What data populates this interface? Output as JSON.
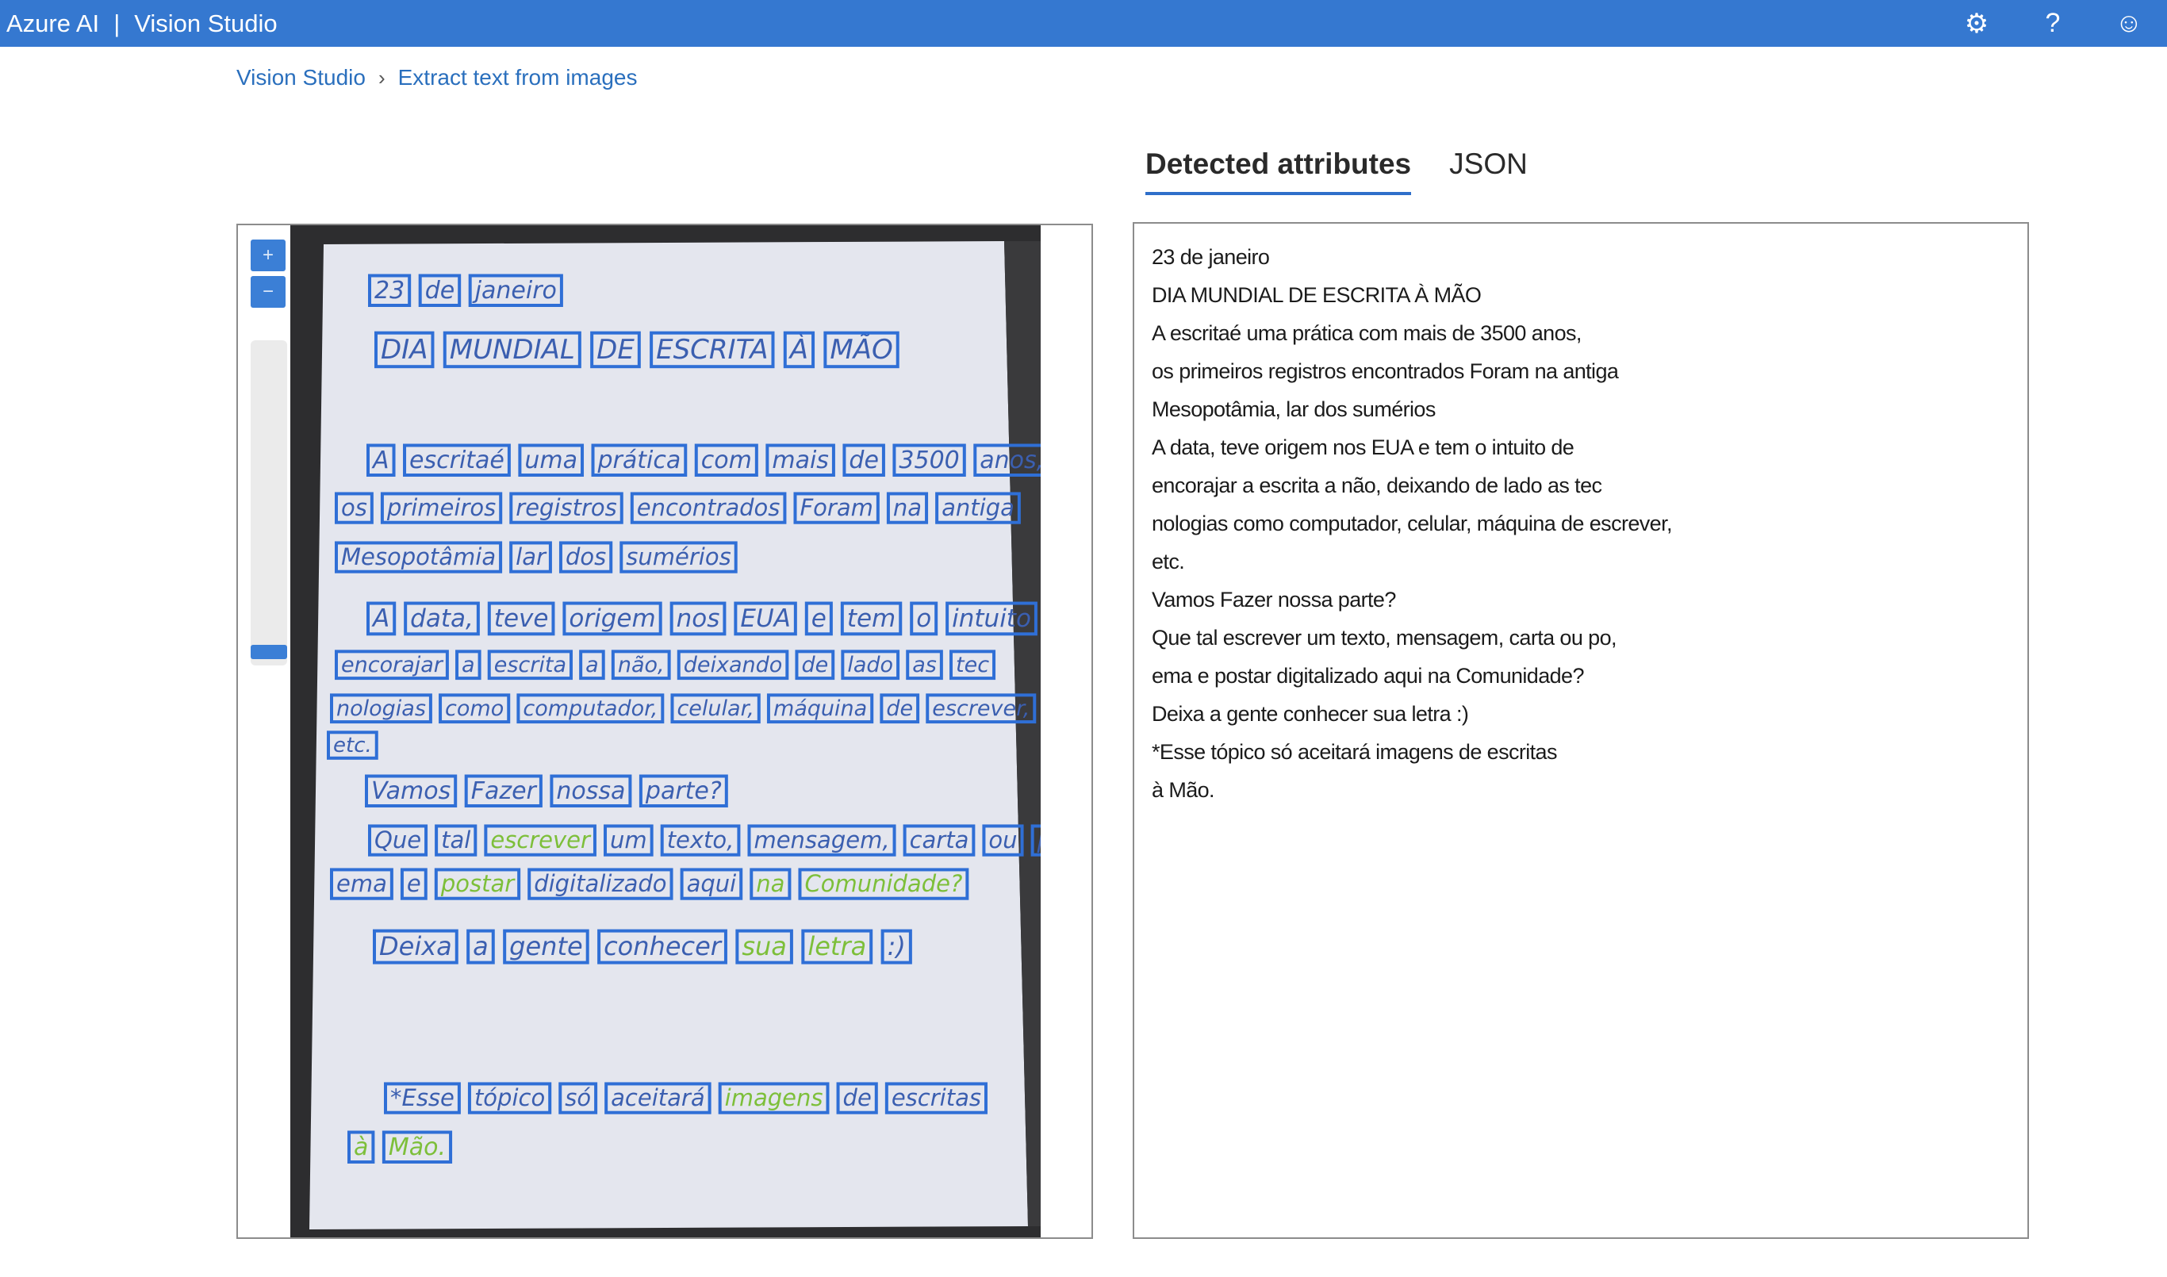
{
  "header": {
    "brand_left": "Azure AI",
    "brand_separator": "|",
    "brand_right": "Vision Studio",
    "icons": [
      "gear-icon",
      "help-icon",
      "feedback-smiley-icon"
    ],
    "icon_glyphs": {
      "settings": "⚙",
      "help": "?",
      "feedback": "☺"
    },
    "bar_color": "#3578d0"
  },
  "breadcrumb": {
    "items": [
      "Vision Studio",
      "Extract text from images"
    ],
    "separator": "›"
  },
  "tabs": [
    {
      "label": "Detected attributes",
      "active": true
    },
    {
      "label": "JSON",
      "active": false
    }
  ],
  "viewer": {
    "zoom_in_label": "+",
    "zoom_out_label": "−",
    "zoom_level": 0.0
  },
  "photo_words": [
    [
      "23",
      "de",
      "janeiro"
    ],
    [
      "DIA",
      "MUNDIAL",
      "DE",
      "ESCRITA",
      "À",
      "MÃO"
    ],
    [
      "A",
      "escritaé",
      "uma",
      "prática",
      "com",
      "mais",
      "de",
      "3500",
      "anos,"
    ],
    [
      "os",
      "primeiros",
      "registros",
      "encontrados",
      "Foram",
      "na",
      "antiga"
    ],
    [
      "Mesopotâmia",
      "lar",
      "dos",
      "sumérios"
    ],
    [
      "A",
      "data,",
      "teve",
      "origem",
      "nos",
      "EUA",
      "e",
      "tem",
      "o",
      "intuito",
      "de"
    ],
    [
      "encorajar",
      "a",
      "escrita",
      "a",
      "não,",
      "deixando",
      "de",
      "lado",
      "as",
      "tec"
    ],
    [
      "nologias",
      "como",
      "computador,",
      "celular,",
      "máquina",
      "de",
      "escrever,"
    ],
    [
      "etc."
    ],
    [
      "Vamos",
      "Fazer",
      "nossa",
      "parte?"
    ],
    [
      "Que",
      "tal",
      "escrever",
      "um",
      "texto,",
      "mensagem,",
      "carta",
      "ou",
      "po,"
    ],
    [
      "ema",
      "e",
      "postar",
      "digitalizado",
      "aqui",
      "na",
      "Comunidade?"
    ],
    [
      "Deixa",
      "a",
      "gente",
      "conhecer",
      "sua",
      "letra",
      ":)"
    ],
    [
      "*Esse",
      "tópico",
      "só",
      "aceitará",
      "imagens",
      "de",
      "escritas"
    ],
    [
      "à",
      "Mão."
    ]
  ],
  "detected_text": [
    "23 de janeiro",
    "DIA MUNDIAL DE ESCRITA À MÃO",
    "A escritaé uma prática com mais de 3500 anos,",
    "os primeiros registros encontrados Foram na antiga",
    "Mesopotâmia, lar dos sumérios",
    "A data, teve origem nos EUA e tem o intuito de",
    "encorajar a escrita a não, deixando de lado as tec",
    "nologias como computador, celular, máquina de escrever,",
    "etc.",
    "Vamos Fazer nossa parte?",
    "Que tal escrever um texto, mensagem, carta ou po,",
    "ema e postar digitalizado aqui na Comunidade?",
    "Deixa a gente conhecer sua letra :)",
    "*Esse tópico só aceitará imagens de escritas",
    "à Mão."
  ],
  "colors": {
    "accent": "#3578d0",
    "box": "#2f6fd6",
    "ink_blue": "#3b5fb0",
    "ink_green": "#7dbf3a",
    "paper": "#e4e6ee"
  }
}
